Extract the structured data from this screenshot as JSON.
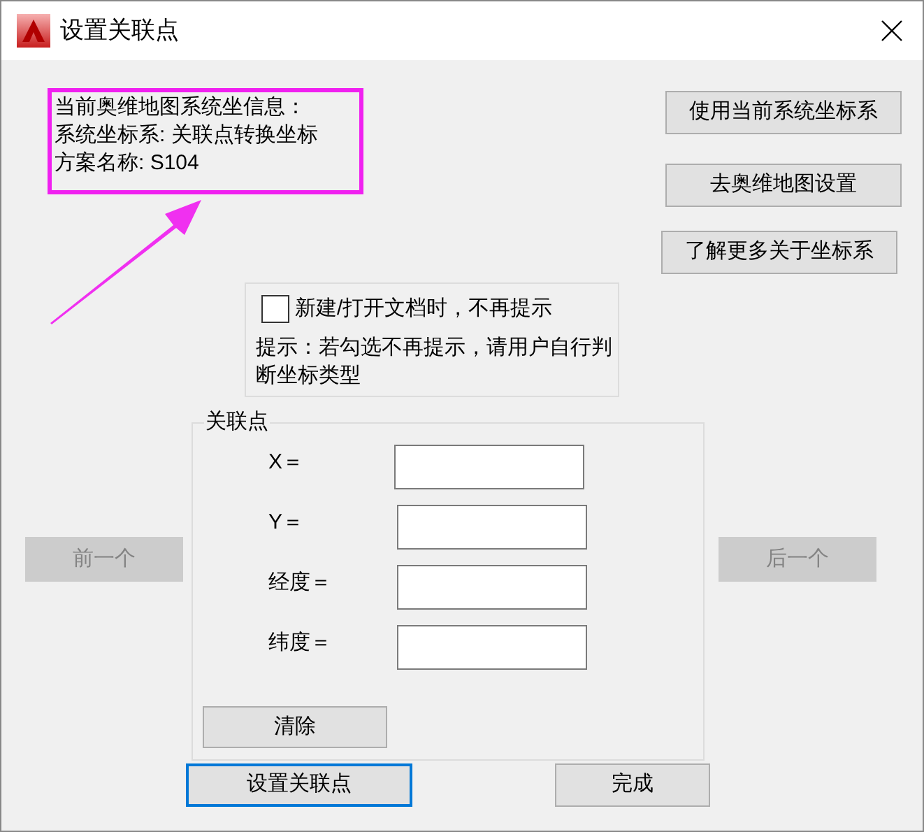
{
  "window": {
    "title": "设置关联点"
  },
  "info_lines": [
    "当前奥维地图系统坐信息：",
    "系统坐标系: 关联点转换坐标",
    "方案名称: S104"
  ],
  "side_buttons": [
    {
      "label": "使用当前系统坐标系"
    },
    {
      "label": "去奥维地图设置"
    },
    {
      "label": "了解更多关于坐标系"
    }
  ],
  "dont_show_again": {
    "label": "新建/打开文档时，不再提示",
    "checked": false
  },
  "hint": "提示：若勾选不再提示，请用户自行判断坐标类型",
  "link_point": {
    "title": "关联点",
    "fields": [
      {
        "label": "X＝"
      },
      {
        "label": "Y＝"
      },
      {
        "label": "经度＝"
      },
      {
        "label": "纬度＝"
      }
    ],
    "clear_button": "清除"
  },
  "prev_button": {
    "label": "前一个",
    "disabled": true
  },
  "next_button": {
    "label": "后一个",
    "disabled": true
  },
  "footer_buttons": [
    {
      "label": "设置关联点",
      "focused": true
    },
    {
      "label": "完成",
      "focused": false
    }
  ]
}
